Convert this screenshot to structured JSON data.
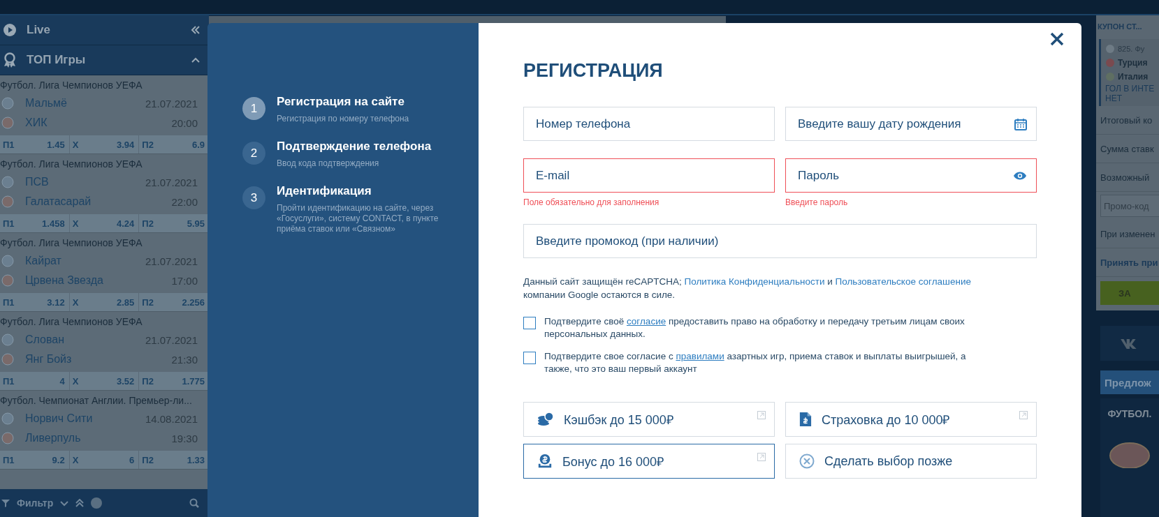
{
  "sidebar": {
    "live": {
      "label": "Live"
    },
    "top": {
      "label": "ТОП Игры",
      "expanded": true
    },
    "matches": [
      {
        "league": "Футбол. Лига Чемпионов УЕФА",
        "team1": "Мальмё",
        "team2": "ХИК",
        "date": "21.07.2021",
        "time": "20:00",
        "odds": [
          {
            "label": "П1",
            "value": "1.45"
          },
          {
            "label": "X",
            "value": "3.94"
          },
          {
            "label": "П2",
            "value": "6.9"
          }
        ]
      },
      {
        "league": "Футбол. Лига Чемпионов УЕФА",
        "team1": "ПСВ",
        "team2": "Галатасарай",
        "date": "21.07.2021",
        "time": "22:00",
        "odds": [
          {
            "label": "П1",
            "value": "1.458"
          },
          {
            "label": "X",
            "value": "4.24"
          },
          {
            "label": "П2",
            "value": "5.95"
          }
        ]
      },
      {
        "league": "Футбол. Лига Чемпионов УЕФА",
        "team1": "Кайрат",
        "team2": "Црвена Звезда",
        "date": "21.07.2021",
        "time": "17:00",
        "odds": [
          {
            "label": "П1",
            "value": "3.12"
          },
          {
            "label": "X",
            "value": "2.85"
          },
          {
            "label": "П2",
            "value": "2.256"
          }
        ]
      },
      {
        "league": "Футбол. Лига Чемпионов УЕФА",
        "team1": "Слован",
        "team2": "Янг Бойз",
        "date": "21.07.2021",
        "time": "21:30",
        "odds": [
          {
            "label": "П1",
            "value": "4"
          },
          {
            "label": "X",
            "value": "3.52"
          },
          {
            "label": "П2",
            "value": "1.775"
          }
        ]
      },
      {
        "league": "Футбол. Чемпионат Англии. Премьер-ли...",
        "team1": "Норвич Сити",
        "team2": "Ливерпуль",
        "date": "14.08.2021",
        "time": "19:30",
        "odds": [
          {
            "label": "П1",
            "value": "9.2"
          },
          {
            "label": "X",
            "value": "6"
          },
          {
            "label": "П2",
            "value": "1.33"
          }
        ]
      }
    ],
    "filter": {
      "label": "Фильтр"
    }
  },
  "coupon": {
    "title": "КУПОН СТ...",
    "event": "825. Фу",
    "team1": "Турция",
    "team2": "Италия",
    "bet": "ГОЛ В ИНТЕ",
    "bet_value": "НЕТ",
    "rows": [
      "Итоговый ко",
      "Сумма ставк",
      "Возможный"
    ],
    "promo_placeholder": "Промо-код",
    "note": "При изменен",
    "accept": "Принять при",
    "submit": "ЗА",
    "offers_tab": "Предлож",
    "sport": "ФУТБОЛ."
  },
  "modal": {
    "steps": [
      {
        "number": "1",
        "title": "Регистрация на сайте",
        "subtitle": "Регистрация по номеру телефона",
        "selected": true
      },
      {
        "number": "2",
        "title": "Подтверждение телефона",
        "subtitle": "Ввод кода подтверждения",
        "selected": false
      },
      {
        "number": "3",
        "title": "Идентификация",
        "subtitle": "Пройти идентификацию на сайте, через «Госуслуги», систему CONTACT, в пункте приёма ставок или «Связном»",
        "selected": false
      }
    ],
    "title": "РЕГИСТРАЦИЯ",
    "fields": [
      {
        "kind": "text",
        "placeholder": "Номер телефона"
      },
      {
        "kind": "date",
        "placeholder": "Введите вашу дату рождения"
      },
      {
        "kind": "text",
        "placeholder": "E-mail",
        "error": "Поле обязательно для заполнения"
      },
      {
        "kind": "password",
        "placeholder": "Пароль",
        "error": "Введите пароль"
      },
      {
        "kind": "wide",
        "placeholder": "Введите промокод (при наличии)"
      }
    ],
    "notice": [
      {
        "kind": "text",
        "text": "Данный сайт защищён reCAPTCHA; "
      },
      {
        "kind": "link",
        "text": "Политика Конфиденциальности"
      },
      {
        "kind": "text",
        "text": " и "
      },
      {
        "kind": "link",
        "text": "Пользовательское соглашение"
      },
      {
        "kind": "text",
        "text": " компании Google остаются в силе."
      }
    ],
    "agreements": [
      {
        "checked": false,
        "parts": [
          {
            "kind": "text",
            "text": "Подтвердите своё "
          },
          {
            "kind": "link",
            "text": "согласие"
          },
          {
            "kind": "text",
            "text": " предоставить право на обработку и передачу третьим лицам своих персональных данных."
          }
        ]
      },
      {
        "checked": false,
        "parts": [
          {
            "kind": "text",
            "text": "Подтвердите свое согласие с "
          },
          {
            "kind": "link",
            "text": "правилами"
          },
          {
            "kind": "text",
            "text": " азартных игр, приема ставок и выплаты выигрышей, а также, что это ваш первый аккаунт"
          }
        ]
      }
    ],
    "bonuses": [
      {
        "kind": "cashback",
        "label": "Кэшбэк до 15 000₽",
        "selected": false
      },
      {
        "kind": "insurance",
        "label": "Страховка до 10 000₽",
        "selected": false
      },
      {
        "kind": "bonus",
        "label": "Бонус до 16 000₽",
        "selected": true
      },
      {
        "kind": "later",
        "label": "Сделать выбор позже",
        "selected": false
      }
    ]
  }
}
